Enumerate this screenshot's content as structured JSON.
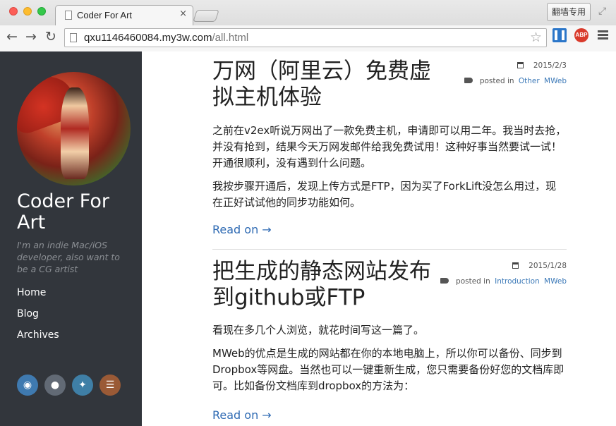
{
  "browser": {
    "tab_title": "Coder For Art",
    "tab_close": "×",
    "proxy_button": "翻墙专用",
    "url_host": "qxu1146460084.my3w.com",
    "url_path": "/all.html",
    "back": "←",
    "forward": "→",
    "reload": "↻",
    "bookmark": "☆",
    "fullscreen": "⤢",
    "ext_abp": "ABP"
  },
  "sidebar": {
    "site_title": "Coder For Art",
    "tagline": "I'm an indie Mac/iOS developer, also want to be a CG artist",
    "nav": [
      {
        "label": "Home"
      },
      {
        "label": "Blog"
      },
      {
        "label": "Archives"
      }
    ],
    "social": [
      {
        "icon": "weibo-icon",
        "glyph": "◉"
      },
      {
        "icon": "github-icon",
        "glyph": "●"
      },
      {
        "icon": "twitter-icon",
        "glyph": "✦"
      },
      {
        "icon": "rss-icon",
        "glyph": "☰"
      }
    ]
  },
  "posts": [
    {
      "title": "万网（阿里云）免费虚拟主机体验",
      "date": "2015/2/3",
      "posted_in": "posted in",
      "categories": [
        "Other",
        "MWeb"
      ],
      "paragraphs": [
        "之前在v2ex听说万网出了一款免费主机，申请即可以用二年。我当时去抢，并没有抢到，结果今天万网发邮件给我免费试用！这种好事当然要试一试！开通很顺利，没有遇到什么问题。",
        "我按步骤开通后，发现上传方式是FTP，因为买了ForkLift没怎么用过，现在正好试试他的同步功能如何。"
      ],
      "read_on": "Read on →"
    },
    {
      "title": "把生成的静态网站发布到github或FTP",
      "date": "2015/1/28",
      "posted_in": "posted in",
      "categories": [
        "Introduction",
        "MWeb"
      ],
      "paragraphs": [
        "看现在多几个人浏览，就花时间写这一篇了。",
        "MWeb的优点是生成的网站都在你的本地电脑上，所以你可以备份、同步到Dropbox等网盘。当然也可以一键重新生成，您只需要备份好您的文档库即可。比如备份文档库到dropbox的方法为："
      ],
      "read_on": "Read on →"
    }
  ],
  "colors": {
    "sidebar_bg": "#32363c",
    "link": "#2e6ab3",
    "category_link": "#3d7ab8"
  }
}
